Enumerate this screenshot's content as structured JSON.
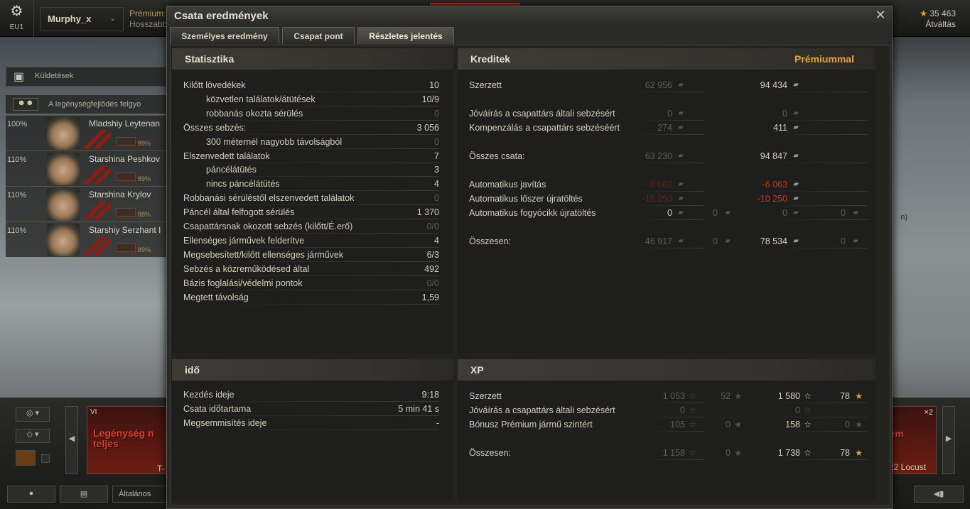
{
  "app": {
    "server": "EU1",
    "player_name": "Murphy_x",
    "premium_label": "Prémium:",
    "premium_extend": "Hosszabb",
    "gold": "35 463",
    "exchange": "Átváltás"
  },
  "garage": {
    "missions_label": "Küldetések",
    "crew_header": "A legénységfejlődés felgyo",
    "crew": [
      {
        "pct": "100%",
        "name": "Mladshiy Leytenan",
        "level": "89%"
      },
      {
        "pct": "110%",
        "name": "Starshina Peshkov",
        "level": "89%"
      },
      {
        "pct": "110%",
        "name": "Starshina Krylov",
        "level": "88%"
      },
      {
        "pct": "110%",
        "name": "Starshiy Serzhant I",
        "level": "89%"
      }
    ],
    "chat_channel": "Általános",
    "vehicle_card": {
      "tier": "VI",
      "status": "Legénység n teljes",
      "name": "T-"
    },
    "right_card": {
      "status": "nem",
      "name": "22 Locust",
      "multiplier": "×2"
    },
    "side_text": "n)"
  },
  "dialog": {
    "title": "Csata eredmények",
    "close": "✕",
    "tabs": [
      "Személyes eredmény",
      "Csapat pont",
      "Részletes jelentés"
    ],
    "active_tab": 2,
    "statistics": {
      "heading": "Statisztika",
      "rows": [
        {
          "label": "Kilőtt lövedékek",
          "value": "10",
          "indent": false,
          "dim": false
        },
        {
          "label": "közvetlen találatok/átütések",
          "value": "10/9",
          "indent": true,
          "dim": false
        },
        {
          "label": "robbanás okozta sérülés",
          "value": "0",
          "indent": true,
          "dim": true
        },
        {
          "label": "Összes sebzés:",
          "value": "3 056",
          "indent": false,
          "dim": false
        },
        {
          "label": "300 méternél nagyobb távolságból",
          "value": "0",
          "indent": true,
          "dim": true
        },
        {
          "label": "Elszenvedett találatok",
          "value": "7",
          "indent": false,
          "dim": false
        },
        {
          "label": "páncélátütés",
          "value": "3",
          "indent": true,
          "dim": false
        },
        {
          "label": "nincs páncélátütés",
          "value": "4",
          "indent": true,
          "dim": false
        },
        {
          "label": "Robbanási sérüléstől elszenvedett találatok",
          "value": "0",
          "indent": false,
          "dim": true
        },
        {
          "label": "Páncél által felfogott sérülés",
          "value": "1 370",
          "indent": false,
          "dim": false
        },
        {
          "label": "Csapattársnak okozott sebzés (kilőtt/É.erő)",
          "value": "0/0",
          "indent": false,
          "dim": true
        },
        {
          "label": "Ellenséges járművek felderítve",
          "value": "4",
          "indent": false,
          "dim": false
        },
        {
          "label": "Megsebesített/kilőtt ellenséges járművek",
          "value": "6/3",
          "indent": false,
          "dim": false
        },
        {
          "label": "Sebzés a közreműködésed által",
          "value": "492",
          "indent": false,
          "dim": false
        },
        {
          "label": "Bázis foglalási/védelmi pontok",
          "value": "0/0",
          "indent": false,
          "dim": true
        },
        {
          "label": "Megtett távolság",
          "value": "1,59",
          "indent": false,
          "dim": false
        }
      ]
    },
    "credits": {
      "heading": "Kreditek",
      "premium_heading": "Prémiummal",
      "rows": [
        {
          "label": "Szerzett",
          "std": "62 956",
          "std_dim": true,
          "prem": "94 434",
          "prem_style": "normal"
        },
        {
          "label": "Jóváírás a csapattárs általi sebzésért",
          "std": "0",
          "std_dim": true,
          "prem": "0",
          "prem_style": "dim"
        },
        {
          "label": "Kompenzálás a csapattárs sebzéséért",
          "std": "274",
          "std_dim": true,
          "prem": "411",
          "prem_style": "normal"
        },
        {
          "label": "Összes csata:",
          "std": "63 230",
          "std_dim": true,
          "prem": "94 847",
          "prem_style": "normal"
        },
        {
          "label": "Automatikus javítás",
          "std": "-6 063",
          "std_dim": "neg",
          "prem": "-6 063",
          "prem_style": "neg"
        },
        {
          "label": "Automatikus lőszer újratöltés",
          "std": "-10 250",
          "std_dim": "neg",
          "prem": "-10 250",
          "prem_style": "neg"
        },
        {
          "label": "Automatikus fogyócikk újratöltés",
          "std": "0",
          "std_dim": false,
          "std_gold": "0",
          "prem": "0",
          "prem_style": "dim",
          "prem_gold": "0"
        },
        {
          "label": "Összesen:",
          "std": "46 917",
          "std_dim": true,
          "std_gold": "0",
          "prem": "78 534",
          "prem_style": "normal",
          "prem_gold": "0"
        }
      ]
    },
    "time": {
      "heading": "idő",
      "rows": [
        {
          "label": "Kezdés ideje",
          "value": "9:18"
        },
        {
          "label": "Csata időtartama",
          "value": "5 min 41 s"
        },
        {
          "label": "Megsemmisítés ideje",
          "value": "-"
        }
      ]
    },
    "xp": {
      "heading": "XP",
      "rows": [
        {
          "label": "Szerzett",
          "xp": "1 053",
          "fxp": "52",
          "pxp": "1 580",
          "pfxp": "78"
        },
        {
          "label": "Jóváírás a csapattárs általi sebzésért",
          "xp": "0",
          "fxp": "",
          "pxp": "0",
          "pfxp": ""
        },
        {
          "label": "Bónusz Prémium jármű szintért",
          "xp": "105",
          "fxp": "0",
          "pxp": "158",
          "pfxp": "0"
        },
        {
          "label": "Összesen:",
          "xp": "1 158",
          "fxp": "0",
          "pxp": "1 738",
          "pfxp": "78"
        }
      ]
    }
  }
}
